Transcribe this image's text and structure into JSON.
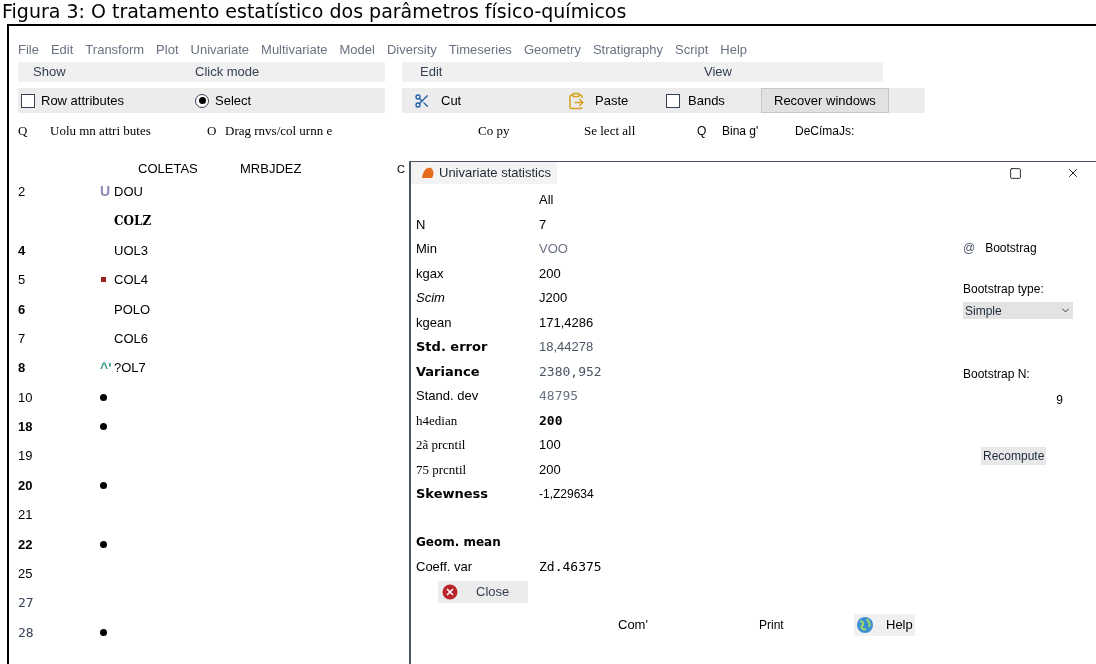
{
  "caption": "Figura 3: O tratamento estatístico dos parâmetros físico-químicos",
  "menu": [
    "File",
    "Edit",
    "Transform",
    "Plot",
    "Univariate",
    "Multivariate",
    "Model",
    "Diversity",
    "Timeseries",
    "Geometry",
    "Stratigraphy",
    "Script",
    "Help"
  ],
  "toolbar": {
    "groups": [
      "Show",
      "Click mode",
      "Edit",
      "View"
    ],
    "row_attributes": {
      "label": "Row attributes",
      "checked": false
    },
    "select": {
      "label": "Select",
      "selected": true
    },
    "cut": "Cut",
    "paste": "Paste",
    "bands": {
      "label": "Bands",
      "checked": false
    },
    "recover": "Recover windows",
    "column_attributes": {
      "glyph": "Q",
      "label": "Uolu mn attri butes"
    },
    "drag": {
      "glyph": "O",
      "label": "Drag rnvs/col urnn e"
    },
    "copy": "Co py",
    "select_all": "Se lect all",
    "binary": {
      "glyph": "Q",
      "label": "Bina g'"
    },
    "decimals": "DeCímaJs:"
  },
  "spreadsheet": {
    "columns": [
      "COLETAS",
      "MRBJDEZ",
      "C"
    ],
    "rows": [
      {
        "number": "2",
        "marker": {
          "kind": "text",
          "text": "U",
          "color": "#8a86b8"
        },
        "cell": "DOU"
      },
      {
        "cell": "COLZ"
      },
      {
        "number": "4",
        "cell": "UOL3"
      },
      {
        "number": "5",
        "marker": {
          "kind": "dot",
          "color": "#a02020"
        },
        "cell": "COL4"
      },
      {
        "number": "6",
        "cell": "POLO"
      },
      {
        "number": "7",
        "cell": "COL6"
      },
      {
        "number": "8",
        "marker": {
          "kind": "text",
          "text": "^'",
          "color": "#3a9a8a"
        },
        "cell": "?OL7"
      },
      {
        "number": "10",
        "marker": {
          "kind": "dot",
          "color": "#000000"
        }
      },
      {
        "number": "18",
        "marker": {
          "kind": "dot",
          "color": "#000000"
        }
      },
      {
        "number": "19"
      },
      {
        "number": "20",
        "marker": {
          "kind": "dot",
          "color": "#000000"
        }
      },
      {
        "number": "21"
      },
      {
        "number": "22",
        "marker": {
          "kind": "dot",
          "color": "#000000"
        }
      },
      {
        "number": "25"
      },
      {
        "number": "27"
      },
      {
        "number": "28",
        "marker": {
          "kind": "dot",
          "color": "#000000"
        }
      }
    ]
  },
  "dialog": {
    "title": "Univariate statistics",
    "header": "All",
    "stats": [
      {
        "label": "N",
        "value": "7"
      },
      {
        "label": "Min",
        "value": "VOO"
      },
      {
        "label": "kgax",
        "value": "200"
      },
      {
        "label": "Scim",
        "value": "J200"
      },
      {
        "label": "kgean",
        "value": "171,4286"
      },
      {
        "label": "Std. error",
        "value": "18,44278"
      },
      {
        "label": "Variance",
        "value": "2380,952"
      },
      {
        "label": "Stand. dev",
        "value": "48795"
      },
      {
        "label": "h4edian",
        "value": "200"
      },
      {
        "label": "2ã prcntil",
        "value": "100"
      },
      {
        "label": "75 prcntil",
        "value": "200"
      },
      {
        "label": "Skewness",
        "value": "-1,Z29634"
      },
      {
        "label": "Geom. mean"
      },
      {
        "label": "Coeff. var",
        "value": "Zd.46375"
      }
    ],
    "close": "Close",
    "copy": "Com'",
    "print": "Print",
    "help": "Help",
    "bootstrap": {
      "glyph": "@",
      "label": "Bootstrag",
      "type_label": "Bootstrap type:",
      "type_value": "Simple",
      "n_label": "Bootstrap N:",
      "n_value": "9",
      "recompute": "Recompute"
    }
  }
}
